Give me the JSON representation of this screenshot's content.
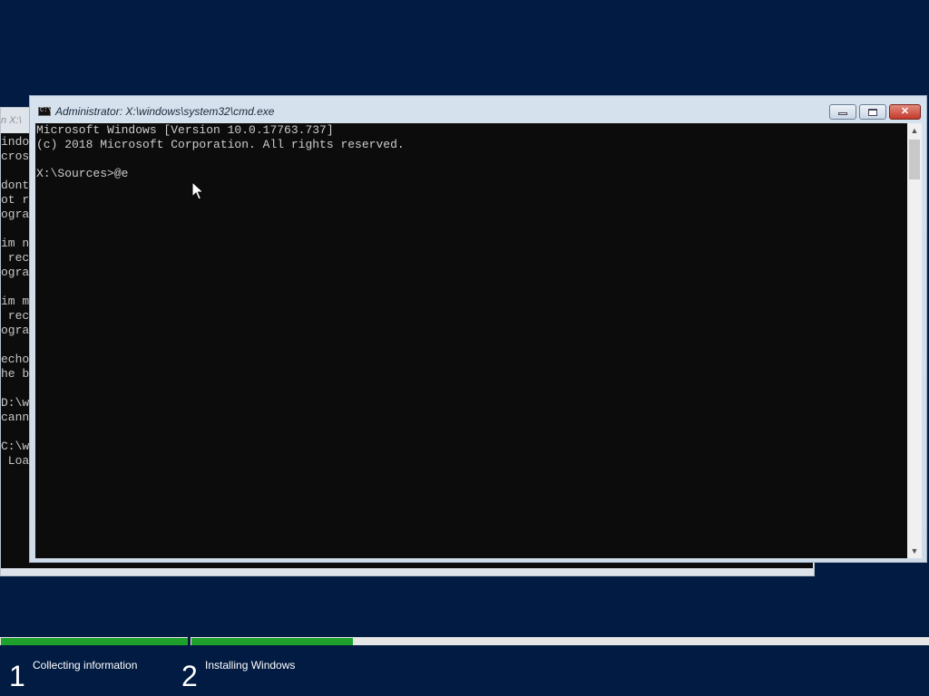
{
  "background_window": {
    "title_fragment": "n X:\\",
    "lines": [
      "indo",
      "cros",
      "",
      "dont",
      "ot r",
      "ogra",
      "",
      "im n",
      " rec",
      "ogra",
      "",
      "im m",
      " rec",
      "ogra",
      "",
      "echo",
      "he b",
      "",
      "D:\\w",
      "cann",
      "",
      "C:\\w",
      " Loa"
    ]
  },
  "cmd_window": {
    "title": "Administrator: X:\\windows\\system32\\cmd.exe",
    "icon": "cmd-icon",
    "icon_text": "C:\\",
    "buttons": {
      "minimize": "minimize",
      "maximize": "maximize",
      "close": "✕"
    },
    "console_lines": [
      "Microsoft Windows [Version 10.0.17763.737]",
      "(c) 2018 Microsoft Corporation. All rights reserved.",
      "",
      "X:\\Sources>@e"
    ]
  },
  "setup_progress": {
    "steps": [
      {
        "number": "1",
        "label": "Collecting information"
      },
      {
        "number": "2",
        "label": "Installing Windows"
      }
    ],
    "colors": {
      "complete": "#1ea12b",
      "track": "#e6e6e6",
      "background": "#011b42"
    }
  }
}
